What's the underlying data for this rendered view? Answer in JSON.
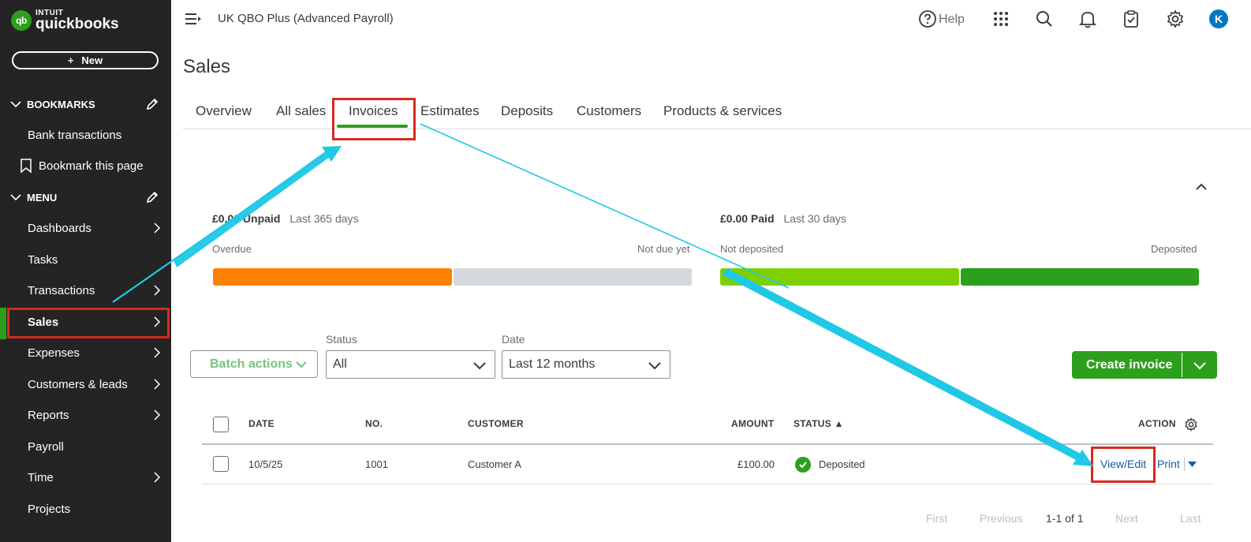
{
  "app": {
    "brand": "INTUIT",
    "product": "quickbooks",
    "company": "UK QBO Plus (Advanced Payroll)"
  },
  "sidebar": {
    "new_label": "New",
    "bookmarks_header": "BOOKMARKS",
    "bookmarks": [
      {
        "label": "Bank transactions"
      },
      {
        "label": "Bookmark this page"
      }
    ],
    "menu_header": "MENU",
    "items": [
      {
        "label": "Dashboards"
      },
      {
        "label": "Tasks"
      },
      {
        "label": "Transactions"
      },
      {
        "label": "Sales"
      },
      {
        "label": "Expenses"
      },
      {
        "label": "Customers & leads"
      },
      {
        "label": "Reports"
      },
      {
        "label": "Payroll"
      },
      {
        "label": "Time"
      },
      {
        "label": "Projects"
      }
    ]
  },
  "topbar": {
    "help_label": "Help",
    "avatar_initial": "K"
  },
  "page": {
    "title": "Sales",
    "tabs": [
      {
        "label": "Overview"
      },
      {
        "label": "All sales"
      },
      {
        "label": "Invoices"
      },
      {
        "label": "Estimates"
      },
      {
        "label": "Deposits"
      },
      {
        "label": "Customers"
      },
      {
        "label": "Products & services"
      }
    ],
    "active_tab": "Invoices"
  },
  "summary": {
    "unpaid_amount": "£0.00 Unpaid",
    "unpaid_period": "Last 365 days",
    "overdue_label": "Overdue",
    "not_due_label": "Not due yet",
    "paid_amount": "£0.00 Paid",
    "paid_period": "Last 30 days",
    "not_deposited_label": "Not deposited",
    "deposited_label": "Deposited",
    "colors": {
      "overdue": "#ff8000",
      "not_due": "#d4d7dc",
      "not_deposited": "#7fd000",
      "deposited": "#2ca01c"
    }
  },
  "filters": {
    "batch_label": "Batch actions",
    "status_label": "Status",
    "status_value": "All",
    "date_label": "Date",
    "date_value": "Last 12 months",
    "create_label": "Create invoice"
  },
  "table": {
    "headers": {
      "date": "DATE",
      "no": "NO.",
      "customer": "CUSTOMER",
      "amount": "AMOUNT",
      "status": "STATUS ▲",
      "action": "ACTION"
    },
    "rows": [
      {
        "date": "10/5/25",
        "no": "1001",
        "customer": "Customer A",
        "amount": "£100.00",
        "status": "Deposited",
        "action_primary": "View/Edit",
        "action_secondary": "Print"
      }
    ]
  },
  "pagination": {
    "first": "First",
    "previous": "Previous",
    "range": "1-1 of 1",
    "next": "Next",
    "last": "Last"
  }
}
